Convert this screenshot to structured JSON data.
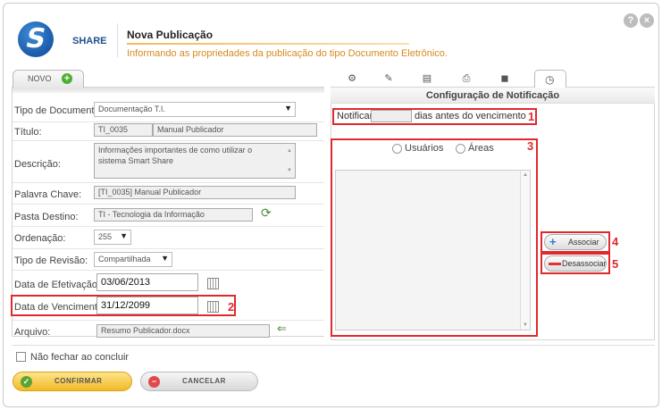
{
  "header": {
    "brand": "SHARE",
    "title": "Nova Publicação",
    "subtitle": "Informando as propriedades da publicação do tipo Documento Eletrônico."
  },
  "window": {
    "help_glyph": "?",
    "close_glyph": "×"
  },
  "left": {
    "tab_label": "NOVO",
    "tipo_documento": {
      "label": "Tipo de Documento:",
      "value": "Documentação T.I."
    },
    "titulo": {
      "label": "Título:",
      "code": "TI_0035",
      "name": "Manual Publicador"
    },
    "descricao": {
      "label": "Descrição:",
      "value": "Informações importantes de como utilizar o sistema Smart Share"
    },
    "palavra_chave": {
      "label": "Palavra Chave:",
      "value": "[TI_0035] Manual Publicador"
    },
    "pasta_destino": {
      "label": "Pasta Destino:",
      "value": "TI - Tecnologia da Informação"
    },
    "ordenacao": {
      "label": "Ordenação:",
      "value": "255"
    },
    "tipo_revisao": {
      "label": "Tipo de Revisão:",
      "value": "Compartilhada"
    },
    "data_efetivacao": {
      "label": "Data de Efetivação:",
      "value": "03/06/2013"
    },
    "data_vencimento": {
      "label": "Data de Vencimento:",
      "value": "31/12/2099"
    },
    "arquivo": {
      "label": "Arquivo:",
      "value": "Resumo Publicador.docx"
    }
  },
  "right": {
    "section_title": "Configuração de Notificação",
    "notificar_label": "Notificar",
    "notificar_value": "",
    "notificar_suffix": "dias antes do vencimento",
    "radio_usuarios": "Usuários",
    "radio_areas": "Áreas",
    "btn_associar": "Associar",
    "btn_desassociar": "Desassociar"
  },
  "markers": {
    "m1": "1",
    "m2": "2",
    "m3": "3",
    "m4": "4",
    "m5": "5"
  },
  "footer": {
    "nao_fechar": "Não fechar ao concluir",
    "confirmar": "CONFIRMAR",
    "cancelar": "CANCELAR"
  },
  "colors": {
    "highlight": "#e0292e",
    "accent_orange": "#d58a1f",
    "brand_blue": "#1f4f8f",
    "confirm_yellow": "#f2b928"
  }
}
